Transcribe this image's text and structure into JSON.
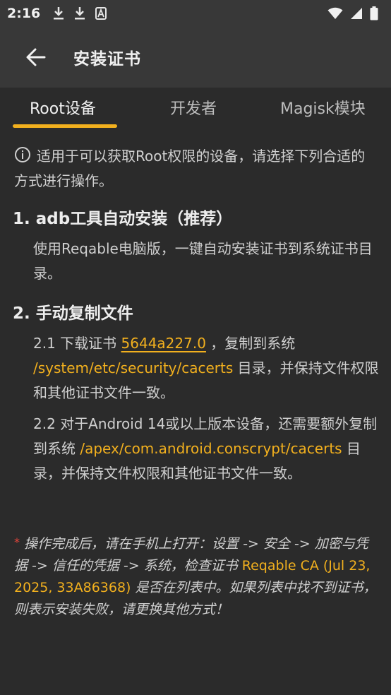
{
  "status_bar": {
    "time": "2:16",
    "left_icons": [
      "download-icon",
      "download-icon",
      "font-a-icon"
    ],
    "right_icons": [
      "wifi-icon",
      "signal-icon",
      "battery-icon"
    ]
  },
  "app_bar": {
    "title": "安装证书"
  },
  "tabs": [
    {
      "label": "Root设备",
      "active": true
    },
    {
      "label": "开发者",
      "active": false
    },
    {
      "label": "Magisk模块",
      "active": false
    }
  ],
  "info": {
    "text": "适用于可以获取Root权限的设备，请选择下列合适的方式进行操作。"
  },
  "section1": {
    "title": "1. adb工具自动安装（推荐）",
    "body": "使用Reqable电脑版，一键自动安装证书到系统证书目录。"
  },
  "section2": {
    "title": "2. 手动复制文件",
    "step1_prefix": "2.1 下载证书 ",
    "step1_link": "5644a227.0",
    "step1_mid": " ，复制到系统 ",
    "step1_path": "/system/etc/security/cacerts",
    "step1_suffix": " 目录，并保持文件权限和其他证书文件一致。",
    "step2_prefix": "2.2 对于Android 14或以上版本设备，还需要额外复制到系统 ",
    "step2_path": "/apex/com.android.conscrypt/cacerts",
    "step2_suffix": " 目录，并保持文件权限和其他证书文件一致。"
  },
  "note": {
    "star": "*",
    "prefix": " 操作完成后，请在手机上打开：设置 -> 安全 -> 加密与凭据 -> 信任的凭据 -> 系统，检查证书 ",
    "cert": "Reqable CA (Jul 23, 2025, 33A86368)",
    "suffix": " 是否在列表中。如果列表中找不到证书，则表示安装失败，请更换其他方式！"
  },
  "colors": {
    "accent": "#f2b01e",
    "background": "#2b2b2b",
    "app_bar": "#383838",
    "warning_star": "#e0443a"
  }
}
